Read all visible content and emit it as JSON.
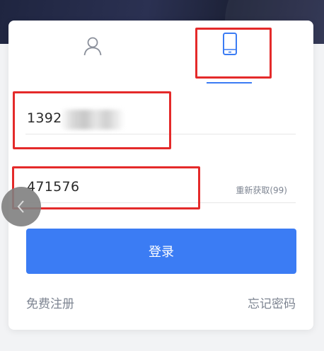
{
  "tabs": {
    "account_icon": "user-icon",
    "phone_icon": "smartphone-icon",
    "active_tab": "phone"
  },
  "form": {
    "phone_value": "1392",
    "code_value": "471576",
    "resend_label": "重新获取(99)"
  },
  "actions": {
    "login_label": "登录",
    "register_label": "免费注册",
    "forgot_label": "忘记密码"
  },
  "colors": {
    "accent": "#3b7cf4",
    "highlight": "#e42a2a",
    "header_bg": "#1f2540"
  },
  "floating": {
    "icon": "chevron-left-icon"
  }
}
